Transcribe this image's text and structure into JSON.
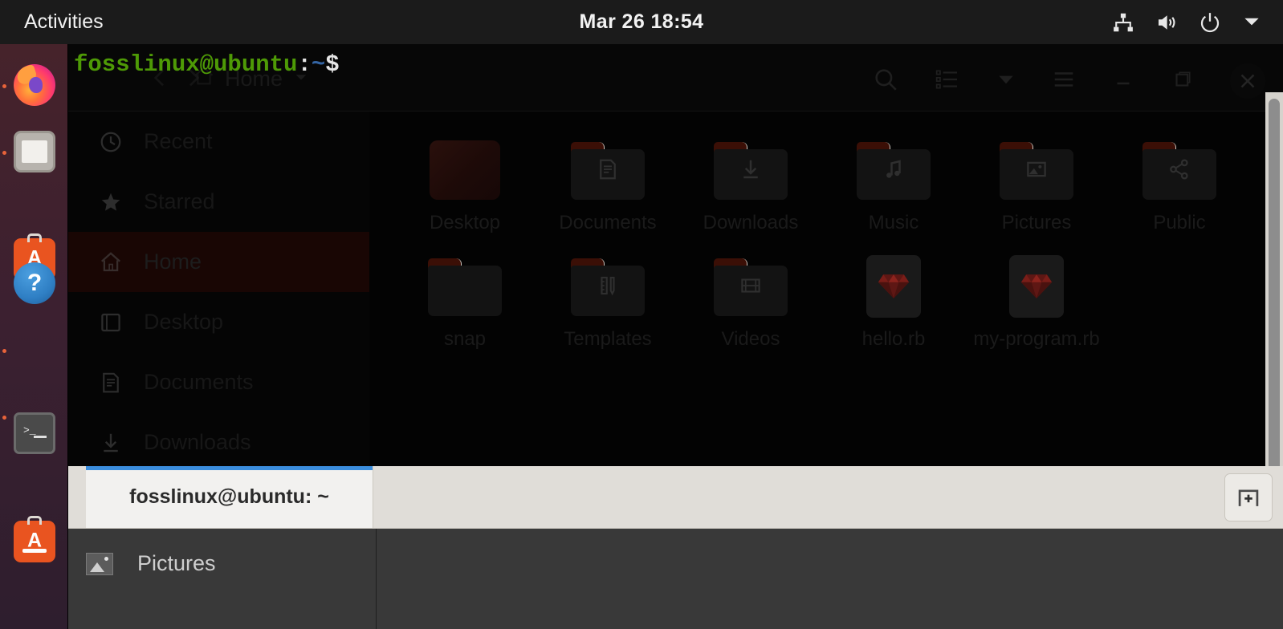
{
  "topbar": {
    "activities": "Activities",
    "clock": "Mar 26  18:54",
    "tray": [
      {
        "name": "network-icon"
      },
      {
        "name": "volume-icon"
      },
      {
        "name": "power-icon"
      },
      {
        "name": "chevron-down-icon"
      }
    ]
  },
  "dock": {
    "items": [
      {
        "label": "Firefox Web Browser",
        "icon": "firefox-icon",
        "running": false
      },
      {
        "label": "Files",
        "icon": "files-icon",
        "running": true
      },
      {
        "label": "Ubuntu Software",
        "icon": "ubuntu-software-icon",
        "running": true
      },
      {
        "label": "Help",
        "icon": "help-icon",
        "running": false
      },
      {
        "label": "Terminal",
        "icon": "terminal-icon",
        "running": true
      },
      {
        "label": "Ubuntu Software",
        "icon": "ubuntu-software-icon",
        "running": true
      }
    ]
  },
  "file_manager": {
    "breadcrumb": "Home",
    "header_icons": [
      {
        "name": "search-icon"
      },
      {
        "name": "list-view-icon"
      },
      {
        "name": "chevron-down-icon"
      },
      {
        "name": "hamburger-menu-icon"
      },
      {
        "name": "minimize-icon"
      },
      {
        "name": "maximize-icon"
      },
      {
        "name": "close-icon"
      }
    ],
    "sidebar": [
      {
        "label": "Recent",
        "icon": "clock-icon",
        "selected": false
      },
      {
        "label": "Starred",
        "icon": "star-icon",
        "selected": false
      },
      {
        "label": "Home",
        "icon": "home-icon",
        "selected": true
      },
      {
        "label": "Desktop",
        "icon": "desktop-icon",
        "selected": false
      },
      {
        "label": "Documents",
        "icon": "documents-icon",
        "selected": false
      },
      {
        "label": "Downloads",
        "icon": "downloads-icon",
        "selected": false
      }
    ],
    "files": [
      {
        "label": "Desktop",
        "kind": "thumbnail",
        "glyph": ""
      },
      {
        "label": "Documents",
        "kind": "folder",
        "glyph": "document-icon"
      },
      {
        "label": "Downloads",
        "kind": "folder",
        "glyph": "download-arrow-icon"
      },
      {
        "label": "Music",
        "kind": "folder",
        "glyph": "music-note-icon"
      },
      {
        "label": "Pictures",
        "kind": "folder",
        "glyph": "image-icon"
      },
      {
        "label": "Public",
        "kind": "folder",
        "glyph": "share-icon"
      },
      {
        "label": "snap",
        "kind": "folder",
        "glyph": ""
      },
      {
        "label": "Templates",
        "kind": "folder",
        "glyph": "ruler-pencil-icon"
      },
      {
        "label": "Videos",
        "kind": "folder",
        "glyph": "film-icon"
      },
      {
        "label": "hello.rb",
        "kind": "ruby",
        "glyph": "ruby-gem-icon"
      },
      {
        "label": "my-program.rb",
        "kind": "ruby",
        "glyph": "ruby-gem-icon"
      }
    ]
  },
  "terminal": {
    "prompt_user": "fosslinux@ubuntu",
    "prompt_colon": ":",
    "prompt_path": "~",
    "prompt_sigil": "$",
    "tab_label": "fosslinux@ubuntu: ~",
    "new_tab_label": "+",
    "bottom_entry": "Pictures"
  },
  "colors": {
    "prompt_green": "#4e9a06",
    "prompt_blue": "#3465a4",
    "tab_active_border": "#3b8ede",
    "dock_running_dot": "#e8633a",
    "ubuntu_orange": "#e95420"
  }
}
